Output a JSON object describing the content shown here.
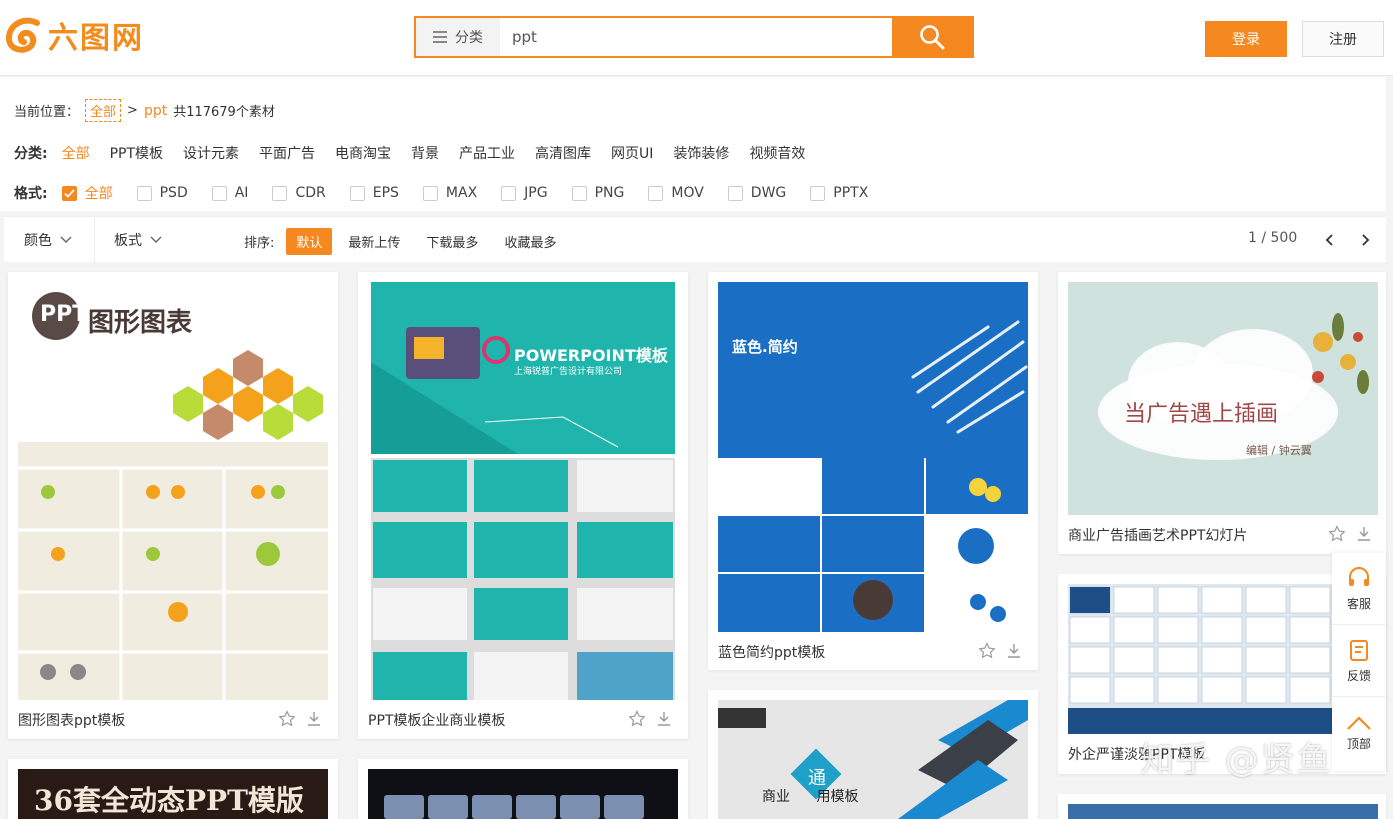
{
  "header": {
    "logo_text": "六图网",
    "search": {
      "category_label": "分类",
      "value": "ppt"
    },
    "login_label": "登录",
    "register_label": "注册"
  },
  "breadcrumb": {
    "label": "当前位置：",
    "all": "全部",
    "sep": ">",
    "keyword": "ppt",
    "count": "共117679个素材"
  },
  "categories": {
    "label": "分类:",
    "items": [
      "全部",
      "PPT模板",
      "设计元素",
      "平面广告",
      "电商淘宝",
      "背景",
      "产品工业",
      "高清图库",
      "网页UI",
      "装饰装修",
      "视频音效"
    ]
  },
  "formats": {
    "label": "格式:",
    "items": [
      "全部",
      "PSD",
      "AI",
      "CDR",
      "EPS",
      "MAX",
      "JPG",
      "PNG",
      "MOV",
      "DWG",
      "PPTX"
    ]
  },
  "toolbar": {
    "color_label": "颜色",
    "layout_label": "板式",
    "sort_label": "排序:",
    "sort_options": [
      "默认",
      "最新上传",
      "下载最多",
      "收藏最多"
    ],
    "page": "1 / 500"
  },
  "cards": [
    {
      "title": "图形图表ppt模板",
      "thumb_text": "图形图表",
      "badge": "PPT"
    },
    {
      "title": "PPT模板企业商业模板",
      "thumb_text": "POWERPOINT模板",
      "sub": "上海锐普广告设计有限公司"
    },
    {
      "title": "蓝色简约ppt模板",
      "thumb_text": "蓝色.简约"
    },
    {
      "title": "商业广告插画艺术PPT幻灯片",
      "thumb_text": "当广告遇上插画",
      "sub": "编辑 / 钟云翼"
    },
    {
      "title": "外企严谨淡雅PPT模板"
    },
    {
      "title": "",
      "thumb_text": "36套全动态PPT模版"
    },
    {
      "title": "",
      "thumb_text": ""
    },
    {
      "title": "",
      "thumb_text": "通",
      "sub": "商业 用模板"
    },
    {
      "title": ""
    }
  ],
  "side": {
    "service": "客服",
    "feedback": "反馈",
    "top": "顶部"
  },
  "watermark": "知乎 @贤鱼",
  "colors": {
    "accent": "#f5881f",
    "teal": "#1fb5ad",
    "blue": "#1a6fc4"
  }
}
